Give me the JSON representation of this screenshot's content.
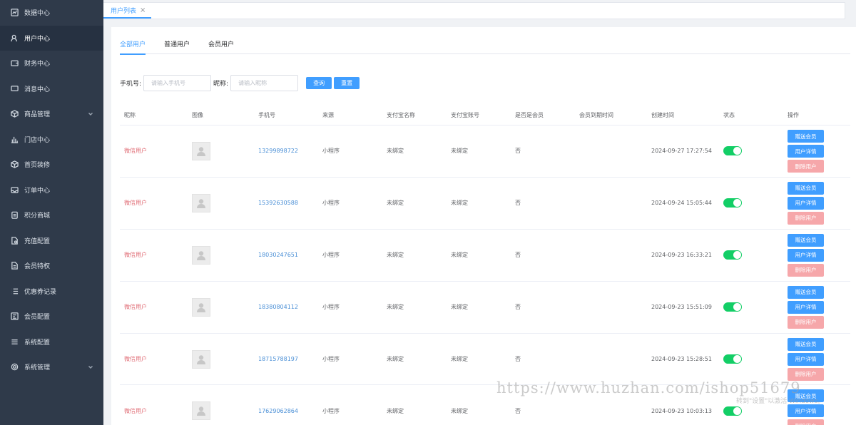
{
  "sidebar": {
    "items": [
      {
        "label": "数据中心",
        "icon": "chart-icon"
      },
      {
        "label": "用户中心",
        "icon": "user-icon",
        "active": true
      },
      {
        "label": "财务中心",
        "icon": "wallet-icon"
      },
      {
        "label": "消息中心",
        "icon": "message-icon"
      },
      {
        "label": "商品管理",
        "icon": "box-icon",
        "expandable": true
      },
      {
        "label": "门店中心",
        "icon": "bar-chart-icon"
      },
      {
        "label": "首页装修",
        "icon": "cube-icon"
      },
      {
        "label": "订单中心",
        "icon": "inbox-icon"
      },
      {
        "label": "积分商城",
        "icon": "clipboard-icon"
      },
      {
        "label": "充值配置",
        "icon": "file-gear-icon"
      },
      {
        "label": "会员特权",
        "icon": "document-icon"
      },
      {
        "label": "优惠券记录",
        "icon": "list-icon"
      },
      {
        "label": "会员配置",
        "icon": "config-icon"
      },
      {
        "label": "系统配置",
        "icon": "menu-icon"
      },
      {
        "label": "系统管理",
        "icon": "gear-icon",
        "expandable": true
      }
    ]
  },
  "tabstrip": {
    "active_tab": "用户列表",
    "close_glyph": "×"
  },
  "subtabs": [
    "全部用户",
    "普通用户",
    "会员用户"
  ],
  "search": {
    "phone_label": "手机号:",
    "phone_placeholder": "请输入手机号",
    "nick_label": "昵称:",
    "nick_placeholder": "请输入昵称",
    "query_label": "查询",
    "reset_label": "重置"
  },
  "table": {
    "headers": [
      "昵称",
      "图像",
      "手机号",
      "来源",
      "支付宝名称",
      "支付宝账号",
      "是否是会员",
      "会员到期时间",
      "创建时间",
      "状态",
      "操作"
    ],
    "ops": {
      "gift": "赠送会员",
      "detail": "用户详情",
      "delete": "删除用户"
    },
    "rows": [
      {
        "nick": "微信用户",
        "phone": "13299898722",
        "source": "小程序",
        "alipay_name": "未绑定",
        "alipay_account": "未绑定",
        "is_member": "否",
        "expire": "",
        "created": "2024-09-27 17:27:54",
        "status_on": true
      },
      {
        "nick": "微信用户",
        "phone": "15392630588",
        "source": "小程序",
        "alipay_name": "未绑定",
        "alipay_account": "未绑定",
        "is_member": "否",
        "expire": "",
        "created": "2024-09-24 15:05:44",
        "status_on": true
      },
      {
        "nick": "微信用户",
        "phone": "18030247651",
        "source": "小程序",
        "alipay_name": "未绑定",
        "alipay_account": "未绑定",
        "is_member": "否",
        "expire": "",
        "created": "2024-09-23 16:33:21",
        "status_on": true
      },
      {
        "nick": "微信用户",
        "phone": "18380804112",
        "source": "小程序",
        "alipay_name": "未绑定",
        "alipay_account": "未绑定",
        "is_member": "否",
        "expire": "",
        "created": "2024-09-23 15:51:09",
        "status_on": true
      },
      {
        "nick": "微信用户",
        "phone": "18715788197",
        "source": "小程序",
        "alipay_name": "未绑定",
        "alipay_account": "未绑定",
        "is_member": "否",
        "expire": "",
        "created": "2024-09-23 15:28:51",
        "status_on": true
      },
      {
        "nick": "微信用户",
        "phone": "17629062864",
        "source": "小程序",
        "alipay_name": "未绑定",
        "alipay_account": "未绑定",
        "is_member": "否",
        "expire": "",
        "created": "2024-09-23 10:03:13",
        "status_on": true
      }
    ]
  },
  "watermark": {
    "text": "https://www.huzhan.com/ishop51679",
    "sub": "转到\"设置\"以激活 Windows。"
  },
  "colors": {
    "sidebar_bg": "#2f3a4a",
    "accent": "#409eff",
    "switch_on": "#13ce66",
    "danger_light": "#f6a7aa",
    "nick_red": "#e06c75"
  }
}
